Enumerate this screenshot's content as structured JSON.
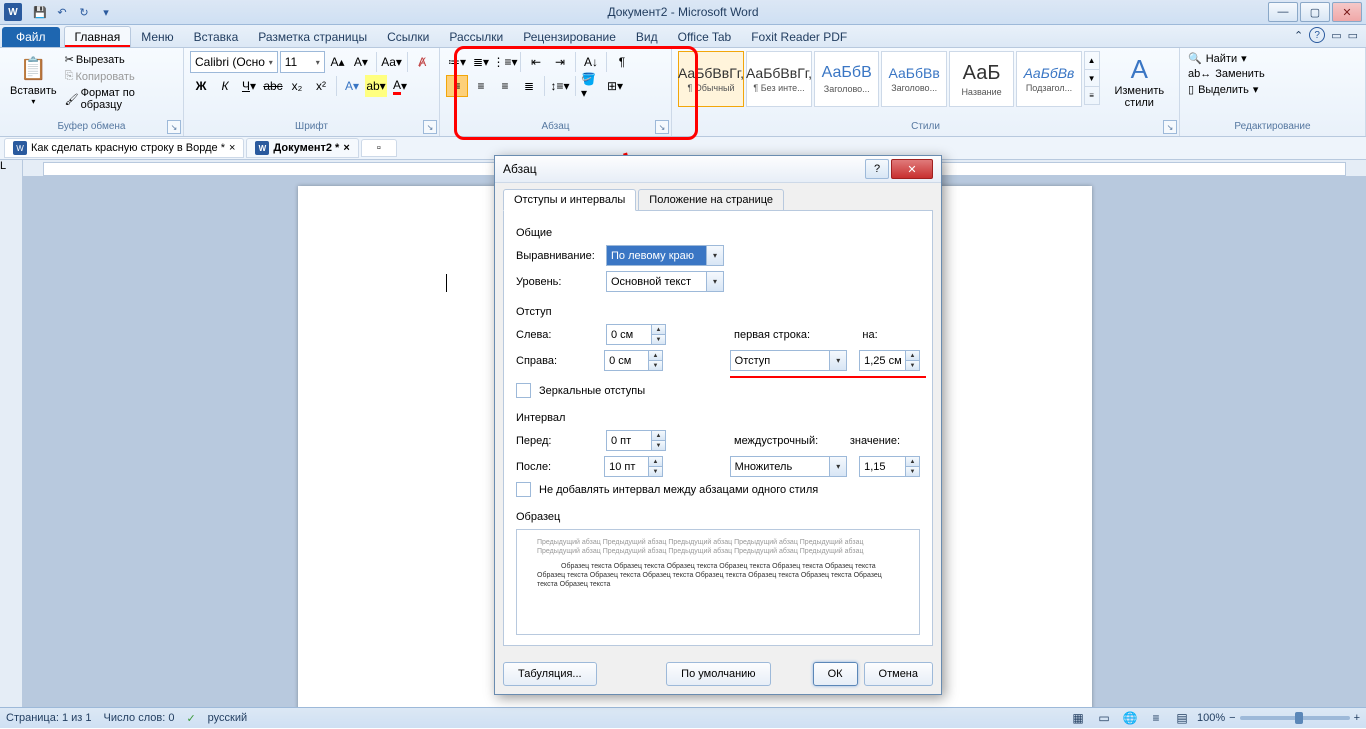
{
  "window": {
    "title": "Документ2 - Microsoft Word",
    "app_letter": "W"
  },
  "tabs": {
    "file": "Файл",
    "items": [
      "Главная",
      "Меню",
      "Вставка",
      "Разметка страницы",
      "Ссылки",
      "Рассылки",
      "Рецензирование",
      "Вид",
      "Office Tab",
      "Foxit Reader PDF"
    ],
    "active": "Главная"
  },
  "ribbon": {
    "clipboard": {
      "label": "Буфер обмена",
      "paste": "Вставить",
      "cut": "Вырезать",
      "copy": "Копировать",
      "format_painter": "Формат по образцу"
    },
    "font": {
      "label": "Шрифт",
      "name": "Calibri (Осно",
      "size": "11"
    },
    "paragraph": {
      "label": "Абзац"
    },
    "styles": {
      "label": "Стили",
      "change": "Изменить стили",
      "items": [
        {
          "preview": "АаБбВвГг,",
          "name": "¶ Обычный"
        },
        {
          "preview": "АаБбВвГг,",
          "name": "¶ Без инте..."
        },
        {
          "preview": "АаБбВ",
          "name": "Заголово..."
        },
        {
          "preview": "АаБбВв",
          "name": "Заголово..."
        },
        {
          "preview": "АаБ",
          "name": "Название"
        },
        {
          "preview": "АаБбВв",
          "name": "Подзагол..."
        }
      ]
    },
    "editing": {
      "label": "Редактирование",
      "find": "Найти",
      "replace": "Заменить",
      "select": "Выделить"
    }
  },
  "doctabs": {
    "items": [
      {
        "label": "Как сделать красную строку в Ворде *"
      },
      {
        "label": "Документ2 *"
      }
    ]
  },
  "dialog": {
    "title": "Абзац",
    "tab1": "Отступы и интервалы",
    "tab2": "Положение на странице",
    "sec_general": "Общие",
    "alignment_lbl": "Выравнивание:",
    "alignment_val": "По левому краю",
    "level_lbl": "Уровень:",
    "level_val": "Основной текст",
    "sec_indent": "Отступ",
    "left_lbl": "Слева:",
    "left_val": "0 см",
    "right_lbl": "Справа:",
    "right_val": "0 см",
    "first_line_lbl": "первая строка:",
    "first_line_val": "Отступ",
    "by_lbl": "на:",
    "by_val": "1,25 см",
    "mirror_lbl": "Зеркальные отступы",
    "sec_spacing": "Интервал",
    "before_lbl": "Перед:",
    "before_val": "0 пт",
    "after_lbl": "После:",
    "after_val": "10 пт",
    "line_lbl": "междустрочный:",
    "line_val": "Множитель",
    "at_lbl": "значение:",
    "at_val": "1,15",
    "no_space_lbl": "Не добавлять интервал между абзацами одного стиля",
    "sec_preview": "Образец",
    "preview_text": "Предыдущий абзац Предыдущий абзац Предыдущий абзац Предыдущий абзац Предыдущий абзац Предыдущий абзац Предыдущий абзац Предыдущий абзац Предыдущий абзац Предыдущий абзац",
    "preview_sample": "Образец текста Образец текста Образец текста Образец текста Образец текста Образец текста Образец текста Образец текста Образец текста Образец текста Образец текста Образец текста Образец текста Образец текста",
    "btn_tabs": "Табуляция...",
    "btn_default": "По умолчанию",
    "btn_ok": "ОК",
    "btn_cancel": "Отмена"
  },
  "status": {
    "page": "Страница: 1 из 1",
    "words": "Число слов: 0",
    "lang": "русский",
    "zoom": "100%"
  }
}
